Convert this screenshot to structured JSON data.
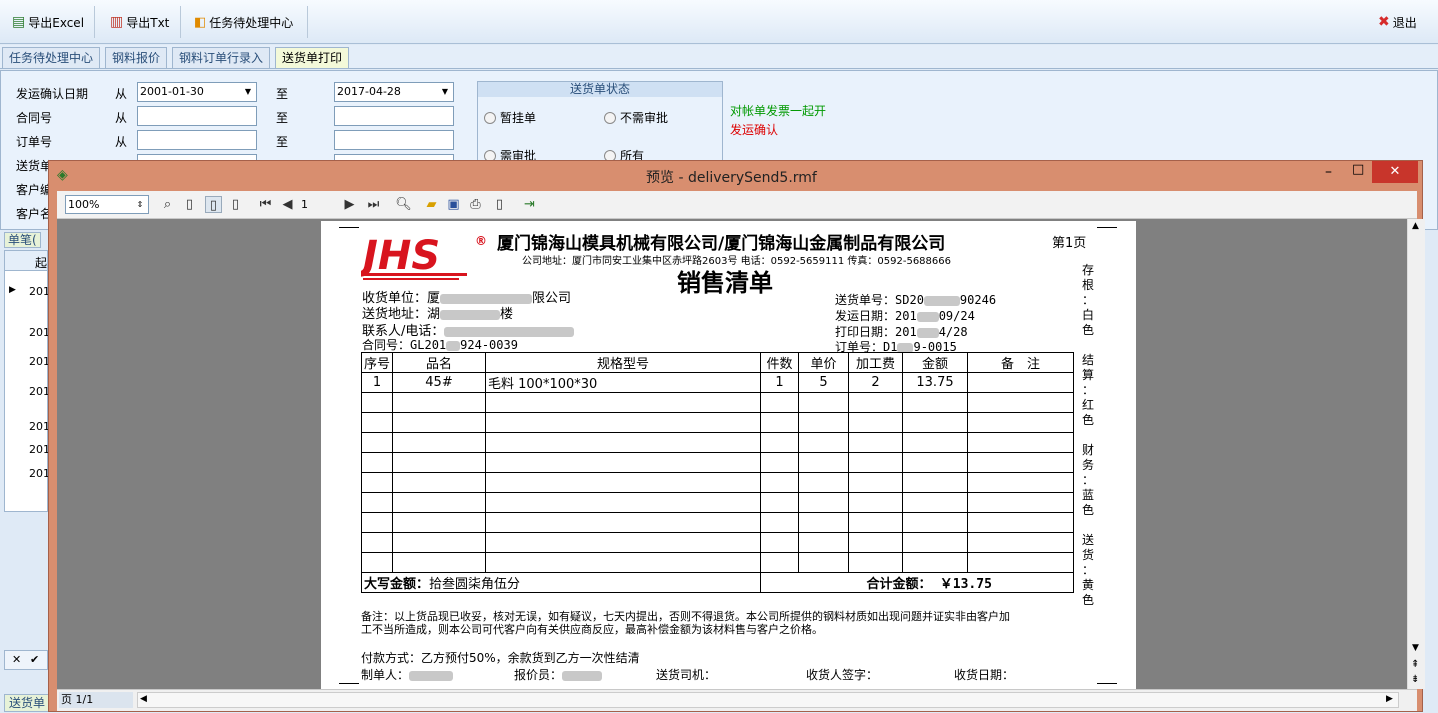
{
  "toolbar": {
    "export_excel": "导出Excel",
    "export_txt": "导出Txt",
    "task_center": "任务待处理中心",
    "exit": "退出"
  },
  "tabs": [
    "任务待处理中心",
    "钢料报价",
    "钢料订单行录入",
    "送货单打印"
  ],
  "filter": {
    "ship_confirm_date": "发运确认日期",
    "contract_no": "合同号",
    "order_no": "订单号",
    "delivery_no": "送货单号",
    "customer_no": "客户编",
    "customer_name": "客户名",
    "from": "从",
    "to": "至",
    "date_from": "2001-01-30",
    "date_to": "2017-04-28"
  },
  "delivery_status": {
    "title": "送货单状态",
    "options": [
      "暂挂单",
      "不需审批",
      "需审批",
      "所有"
    ]
  },
  "notes": {
    "green": "对帐单发票一起开",
    "red": "发运确认"
  },
  "bg_tab": "单笔(",
  "bg_header": "起",
  "bg_rows": [
    "201",
    "201",
    "201",
    "201",
    "201",
    "201",
    "201"
  ],
  "bottom_tab": "送货单",
  "preview": {
    "title": "预览 - deliverySend5.rmf",
    "zoom": "100%",
    "page_input": "1",
    "status": "页 1/1"
  },
  "doc": {
    "company": "厦门锦海山模具机械有限公司/厦门锦海山金属制品有限公司",
    "page_label": "第1页",
    "address_line": "公司地址：厦门市同安工业集中区赤坪路2603号 电话：0592-5659111 传真：0592-5688666",
    "title": "销售清单",
    "receiver_label": "收货单位：",
    "receiver_visible": "厦",
    "receiver_tail": "限公司",
    "address_label": "送货地址：",
    "address_visible": "湖",
    "address_tail": "楼",
    "contact_label": "联系人/电话：",
    "contract_label": "合同号：",
    "contract_head": "GL201",
    "contract_tail": "924-0039",
    "delivery_label": "送货单号：",
    "delivery_head": "SD20",
    "delivery_tail": "90246",
    "ship_date_label": "发运日期：",
    "ship_date_head": "201",
    "ship_date_tail": "09/24",
    "print_date_label": "打印日期：",
    "print_date_head": "201",
    "print_date_tail": "4/28",
    "order_label": "订单号：",
    "order_head": "D1",
    "order_tail": "9-0015",
    "columns": [
      "序号",
      "品名",
      "规格型号",
      "件数",
      "单价",
      "加工费",
      "金额",
      "备　注"
    ],
    "rows": [
      [
        "1",
        "45#",
        "毛料 100*100*30",
        "1",
        "5",
        "2",
        "13.75",
        ""
      ]
    ],
    "amount_words_label": "大写金额：",
    "amount_words": "拾叁圆柒角伍分",
    "total_label": "合计金额：",
    "total": "￥13.75",
    "remark": "备注：以上货品现已收妥，核对无误，如有疑议，七天内提出，否则不得退货。本公司所提供的钢料材质如出现问题并证实非由客户加",
    "remark2": "工不当所造成，则本公司可代客户向有关供应商反应，最高补偿金额为该材料售与客户之价格。",
    "payment": "付款方式：乙方预付50%，余款货到乙方一次性结清",
    "maker": "制单人：",
    "quoter": "报价员：",
    "driver": "送货司机：",
    "signer": "收货人签字：",
    "recv_date": "收货日期：",
    "side_labels": [
      "存",
      "根",
      "：",
      "白",
      "色",
      "结",
      "算",
      "：",
      "红",
      "色",
      "财",
      "务",
      "：",
      "蓝",
      "色",
      "送",
      "货",
      "：",
      "黄",
      "色"
    ]
  },
  "colors": {
    "titlebar": "#d88e6f",
    "logo_red": "#d8141e",
    "note_green": "#009900",
    "note_red": "#dd0000",
    "close_red": "#c8352b"
  }
}
